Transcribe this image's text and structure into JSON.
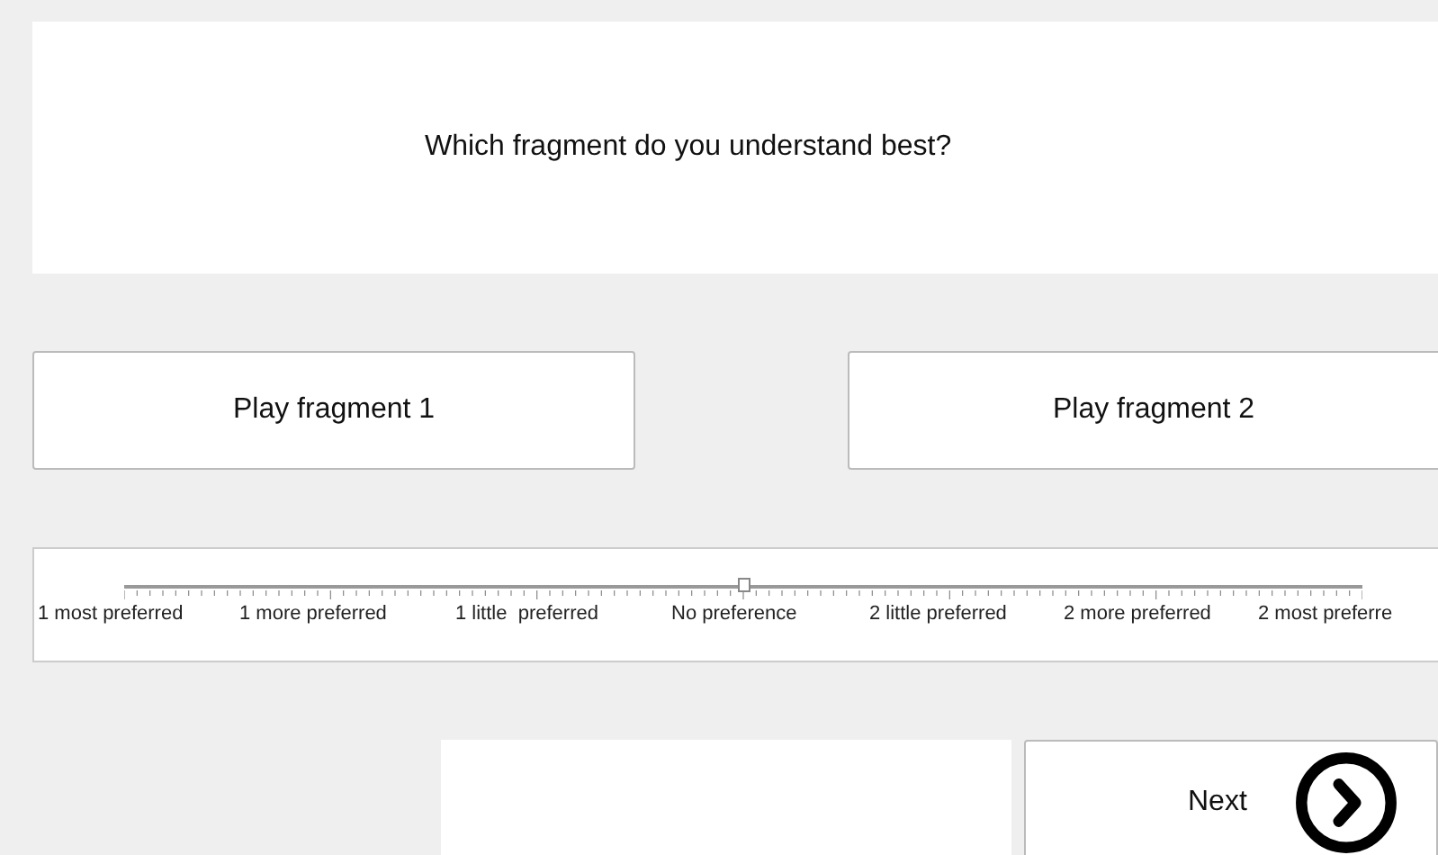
{
  "question": "Which fragment do you understand best?",
  "play_buttons": [
    "Play fragment 1",
    "Play fragment 2"
  ],
  "scale": {
    "level": 0.5,
    "labels": [
      "1 most preferred",
      "1 more preferred",
      "1 little  preferred",
      "No preference",
      "2 little preferred",
      "2 more preferred",
      "2 most preferre"
    ]
  },
  "next_button": "Next"
}
